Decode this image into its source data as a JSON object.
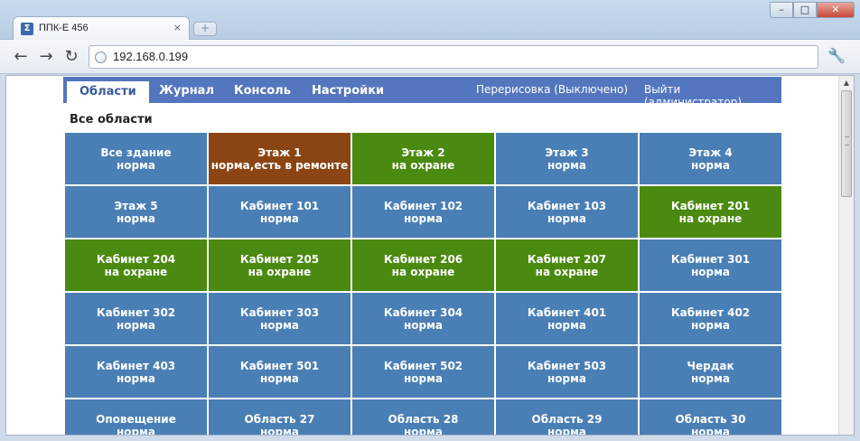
{
  "browser": {
    "tab_title": "ППК-Е 456",
    "tab_close": "×",
    "newtab": "+",
    "url": "192.168.0.199",
    "back": "←",
    "forward": "→",
    "reload": "↻",
    "wrench": "🔧",
    "win_min": "–",
    "win_max": "□",
    "win_close": "✕"
  },
  "nav": {
    "tabs": [
      "Области",
      "Журнал",
      "Консоль",
      "Настройки"
    ],
    "redraw": "Перерисовка (Выключено)",
    "logout": "Выйти (администратор)"
  },
  "section_title": "Все области",
  "colors": {
    "normal": "#4a7fb5",
    "armed": "#4a8a10",
    "repair": "#8b4513",
    "nav": "#5476be"
  },
  "areas": [
    {
      "name": "Все здание",
      "status": "норма",
      "state": "normal"
    },
    {
      "name": "Этаж 1",
      "status": "норма,есть в ремонте",
      "state": "repair"
    },
    {
      "name": "Этаж 2",
      "status": "на охране",
      "state": "armed"
    },
    {
      "name": "Этаж 3",
      "status": "норма",
      "state": "normal"
    },
    {
      "name": "Этаж 4",
      "status": "норма",
      "state": "normal"
    },
    {
      "name": "Этаж 5",
      "status": "норма",
      "state": "normal"
    },
    {
      "name": "Кабинет 101",
      "status": "норма",
      "state": "normal"
    },
    {
      "name": "Кабинет 102",
      "status": "норма",
      "state": "normal"
    },
    {
      "name": "Кабинет 103",
      "status": "норма",
      "state": "normal"
    },
    {
      "name": "Кабинет 201",
      "status": "на охране",
      "state": "armed"
    },
    {
      "name": "Кабинет 204",
      "status": "на охране",
      "state": "armed"
    },
    {
      "name": "Кабинет 205",
      "status": "на охране",
      "state": "armed"
    },
    {
      "name": "Кабинет 206",
      "status": "на охране",
      "state": "armed"
    },
    {
      "name": "Кабинет 207",
      "status": "на охране",
      "state": "armed"
    },
    {
      "name": "Кабинет 301",
      "status": "норма",
      "state": "normal"
    },
    {
      "name": "Кабинет 302",
      "status": "норма",
      "state": "normal"
    },
    {
      "name": "Кабинет 303",
      "status": "норма",
      "state": "normal"
    },
    {
      "name": "Кабинет 304",
      "status": "норма",
      "state": "normal"
    },
    {
      "name": "Кабинет 401",
      "status": "норма",
      "state": "normal"
    },
    {
      "name": "Кабинет 402",
      "status": "норма",
      "state": "normal"
    },
    {
      "name": "Кабинет 403",
      "status": "норма",
      "state": "normal"
    },
    {
      "name": "Кабинет 501",
      "status": "норма",
      "state": "normal"
    },
    {
      "name": "Кабинет 502",
      "status": "норма",
      "state": "normal"
    },
    {
      "name": "Кабинет 503",
      "status": "норма",
      "state": "normal"
    },
    {
      "name": "Чердак",
      "status": "норма",
      "state": "normal"
    },
    {
      "name": "Оповещение",
      "status": "норма",
      "state": "normal"
    },
    {
      "name": "Область 27",
      "status": "норма",
      "state": "normal"
    },
    {
      "name": "Область 28",
      "status": "норма",
      "state": "normal"
    },
    {
      "name": "Область 29",
      "status": "норма",
      "state": "normal"
    },
    {
      "name": "Область 30",
      "status": "норма",
      "state": "normal"
    }
  ]
}
